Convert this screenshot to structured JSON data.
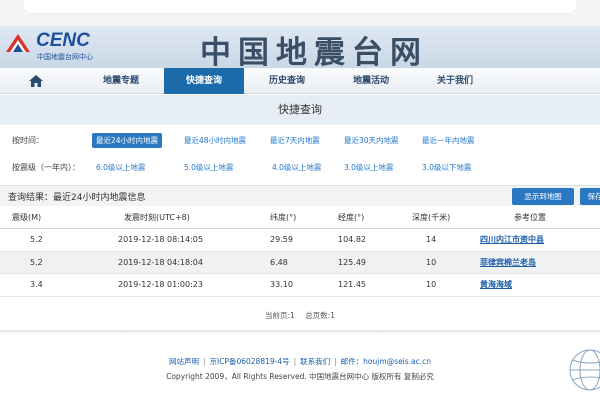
{
  "brand": {
    "logo_text": "CENC",
    "logo_sub": "中国地震台网中心",
    "calligraphy": "中国地震台网",
    "logo_colors": [
      "#d9302b",
      "#1d4f9c"
    ]
  },
  "nav": {
    "items": [
      {
        "label": "地震专题"
      },
      {
        "label": "快捷查询",
        "active": true
      },
      {
        "label": "历史查询"
      },
      {
        "label": "地震活动"
      },
      {
        "label": "关于我们"
      }
    ],
    "active_color": "#1c6aa8"
  },
  "page_title": "快捷查询",
  "filters": {
    "time": {
      "label": "按时间：",
      "options": [
        "最近24小时内地震",
        "最近48小时内地震",
        "最近7天内地震",
        "最近30天内地震",
        "最近一年内地震"
      ],
      "selected": "最近24小时内地震"
    },
    "magnitude": {
      "label": "按震级（一年内）：",
      "options": [
        "6.0级以上地震",
        "5.0级以上地震",
        "4.0级以上地震",
        "3.0级以上地震",
        "3.0级以下地震"
      ]
    }
  },
  "results": {
    "title": "查询结果：最近24小时内地震信息",
    "map_button": "显示到地图",
    "save_button": "保存",
    "columns": [
      "震级(M)",
      "发震时刻(UTC+8)",
      "纬度(°)",
      "经度(°)",
      "深度(千米)",
      "参考位置"
    ],
    "rows": [
      {
        "mag": "5.2",
        "time": "2019-12-18 08:14:05",
        "lat": "29.59",
        "lon": "104.82",
        "depth": "14",
        "location": "四川内江市资中县"
      },
      {
        "mag": "5.2",
        "time": "2019-12-18 04:18:04",
        "lat": "6.48",
        "lon": "125.49",
        "depth": "10",
        "location": "菲律宾棉兰老岛"
      },
      {
        "mag": "3.4",
        "time": "2019-12-18 01:00:23",
        "lat": "33.10",
        "lon": "121.45",
        "depth": "10",
        "location": "黄海海域"
      }
    ]
  },
  "pager": {
    "current": "当前页:1",
    "total": "总页数:1"
  },
  "footer": {
    "statement": "网站声明",
    "icp": "京ICP备06028819-4号",
    "contact_label": "联系我们",
    "email": "邮件：houjm@seis.ac.cn",
    "copyright": "Copyright 2009，All Rights Reserved. 中国地震台网中心 版权所有 复制必究"
  }
}
